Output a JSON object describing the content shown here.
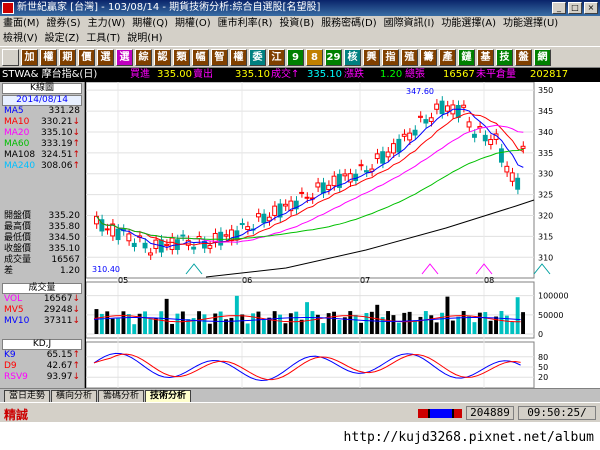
{
  "titlebar": {
    "title": "新世紀贏家 [台灣] - 103/08/14 - 期貨技術分析:綜合自選股[名望股]"
  },
  "menu": {
    "row1": [
      "畫面(M)",
      "證券(S)",
      "主力(W)",
      "期權(Q)",
      "期權(O)",
      "匯市利率(R)",
      "投資(B)",
      "服務密碼(D)",
      "國際資訊(I)",
      "功能選擇(A)",
      "功能選擇(U)"
    ],
    "row2": [
      "檢視(V)",
      "設定(Z)",
      "工具(T)",
      "說明(H)"
    ]
  },
  "toolbar": {
    "buttons": [
      {
        "label": "",
        "color": "#d4d0c8"
      },
      {
        "label": "加",
        "color": "#804000"
      },
      {
        "label": "權",
        "color": "#804000"
      },
      {
        "label": "期",
        "color": "#804000"
      },
      {
        "label": "價",
        "color": "#804000"
      },
      {
        "label": "選",
        "color": "#804000"
      },
      {
        "label": "選",
        "color": "#c000c0"
      },
      {
        "label": "綜",
        "color": "#804000"
      },
      {
        "label": "認",
        "color": "#804000"
      },
      {
        "label": "類",
        "color": "#804000"
      },
      {
        "label": "幅",
        "color": "#804000"
      },
      {
        "label": "智",
        "color": "#804000"
      },
      {
        "label": "權",
        "color": "#804000"
      },
      {
        "label": "委",
        "color": "#008080"
      },
      {
        "label": "江",
        "color": "#804000"
      },
      {
        "label": "9",
        "color": "#008000"
      },
      {
        "label": "8",
        "color": "#c08000"
      },
      {
        "label": "29",
        "color": "#008000"
      },
      {
        "label": "核",
        "color": "#008080"
      },
      {
        "label": "興",
        "color": "#804000"
      },
      {
        "label": "指",
        "color": "#804000"
      },
      {
        "label": "殖",
        "color": "#804000"
      },
      {
        "label": "籌",
        "color": "#804000"
      },
      {
        "label": "產",
        "color": "#804000"
      },
      {
        "label": "鏈",
        "color": "#008000"
      },
      {
        "label": "基",
        "color": "#804000"
      },
      {
        "label": "技",
        "color": "#008000"
      },
      {
        "label": "盤",
        "color": "#804000"
      },
      {
        "label": "網",
        "color": "#008000"
      }
    ]
  },
  "quote": {
    "symbol": "STWA& 摩台指&(日)",
    "bid_label": "買進",
    "bid": "335.00",
    "ask_label": "賣出",
    "ask": "335.10",
    "last_label": "成交↑",
    "last": "335.10",
    "change_label": "漲跌",
    "change": "1.20",
    "volume_label": "總張",
    "volume": "16567",
    "oi_label": "未平倉量",
    "oi": "202817"
  },
  "side": {
    "k_head": "K線圖",
    "date": "2014/08/14",
    "ma": [
      {
        "label": "MA5",
        "value": "331.28",
        "arrow": "",
        "color": "#0000ff"
      },
      {
        "label": "MA10",
        "value": "330.21",
        "arrow": "↓",
        "color": "#ff0000"
      },
      {
        "label": "MA20",
        "value": "335.10",
        "arrow": "↓",
        "color": "#ff00ff"
      },
      {
        "label": "MA60",
        "value": "333.19",
        "arrow": "↑",
        "color": "#00c000"
      },
      {
        "label": "MA108",
        "value": "324.51",
        "arrow": "↑",
        "color": "#000000"
      },
      {
        "label": "MA240",
        "value": "308.06",
        "arrow": "↑",
        "color": "#00c0ff"
      }
    ],
    "price": [
      {
        "label": "開盤價",
        "value": "335.20"
      },
      {
        "label": "最高價",
        "value": "335.80"
      },
      {
        "label": "最低價",
        "value": "334.50"
      },
      {
        "label": "收盤價",
        "value": "335.10"
      },
      {
        "label": "成交量",
        "value": "16567"
      },
      {
        "label": "差",
        "value": "1.20"
      }
    ],
    "vol_head": "成交量",
    "vol": [
      {
        "label": "VOL",
        "value": "16567",
        "arrow": "↓",
        "color": "#ff00ff"
      },
      {
        "label": "MV5",
        "value": "29248",
        "arrow": "↓",
        "color": "#ff0000"
      },
      {
        "label": "MV10",
        "value": "37311",
        "arrow": "↓",
        "color": "#0000ff"
      }
    ],
    "kd_head": "KD,J",
    "kd": [
      {
        "label": "K9",
        "value": "65.15",
        "arrow": "↑",
        "color": "#0000ff"
      },
      {
        "label": "D9",
        "value": "42.67",
        "arrow": "↑",
        "color": "#ff0000"
      },
      {
        "label": "RSV9",
        "value": "93.97",
        "arrow": "↓",
        "color": "#ff00ff"
      }
    ]
  },
  "chart_data": [
    {
      "type": "candlestick",
      "y_ticks": [
        "350",
        "345",
        "340",
        "335",
        "330",
        "325",
        "320",
        "315",
        "310"
      ],
      "x_ticks": [
        "05",
        "06",
        "07",
        "08"
      ],
      "ylim": [
        306,
        351
      ],
      "annotations": {
        "high_label": "347.60",
        "low_label": "310.40"
      }
    },
    {
      "type": "bar",
      "y_ticks": [
        "100000",
        "50000",
        "0"
      ],
      "ylim": [
        0,
        120000
      ]
    },
    {
      "type": "line",
      "y_ticks": [
        "80",
        "50",
        "20"
      ],
      "ylim": [
        0,
        100
      ]
    }
  ],
  "tabs": [
    "當日走勢",
    "橫向分析",
    "籌碼分析",
    "技術分析"
  ],
  "status": {
    "left": "精誠",
    "counter": "204889",
    "time": "09:50:25/"
  },
  "footer": {
    "url": "http://kujd3268.pixnet.net/album"
  }
}
